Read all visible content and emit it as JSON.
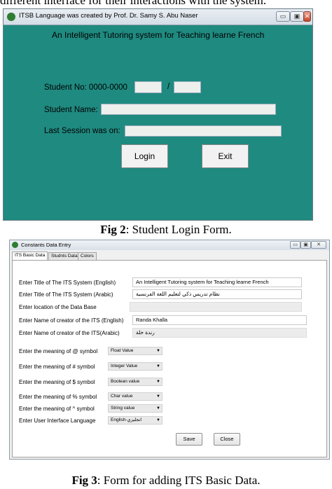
{
  "top_text": "different interface for their interactions with the system.",
  "login_window": {
    "title": "ITSB Language was created by Prof. Dr. Samy S. Abu Naser",
    "titlebar_buttons": {
      "minimize": "▭",
      "maximize": "▣",
      "close": "✕"
    },
    "heading": "An Intelligent Tutoring  system for  Teaching  learne French",
    "student_no_label": "Student No: 0000-0000",
    "student_no_separator": "/",
    "student_name_label": "Student Name:",
    "last_session_label": "Last Session was on:",
    "login_button": "Login",
    "exit_button": "Exit",
    "background_color": "#1f8a80"
  },
  "caption1": {
    "fig": "Fig 2",
    "text": ": Student Login Form."
  },
  "constants_window": {
    "title": "Constants Data Entry",
    "titlebar_buttons": {
      "minimize": "▭",
      "maximize": "▣",
      "close": "✕"
    },
    "tabs": [
      {
        "label": "ITS Basic Data",
        "active": true
      },
      {
        "label": "Studnts Data",
        "active": false
      },
      {
        "label": "Colors",
        "active": false
      }
    ],
    "fields": [
      {
        "label": "Enter Title of The ITS System (English)",
        "value": "An Intelligent Tutoring  system for  Teaching  learne French"
      },
      {
        "label": "Enter Title of The ITS System (Arabic)",
        "value": "نظام تدريس ذكي لتعليم اللغة الفرنسية"
      },
      {
        "label": "Enter location of the Data Base",
        "value": ""
      },
      {
        "label": "Enter Name of creator of the ITS (English)",
        "value": "Randa Khalla"
      },
      {
        "label": "Enter Name of creator of the ITS(Arabic)",
        "value": "رندة خلة"
      }
    ],
    "symbols": [
      {
        "label": "Enter the meaning of @ symbol",
        "value": "Float Value"
      },
      {
        "label": "Enter the meaning of # symbol",
        "value": "Integer Value"
      },
      {
        "label": "Enter the meaning of $ symbol",
        "value": "Boolean value"
      },
      {
        "label": "Enter the meaning of % symbol",
        "value": "Char value"
      },
      {
        "label": "Enter the meaning of ^ symbol",
        "value": "String value"
      },
      {
        "label": "Enter User Interface Language",
        "value": "English-انجليزي"
      }
    ],
    "save_button": "Save",
    "close_button": "Close"
  },
  "caption2": {
    "fig": "Fig 3",
    "text": ": Form for adding ITS Basic Data."
  }
}
